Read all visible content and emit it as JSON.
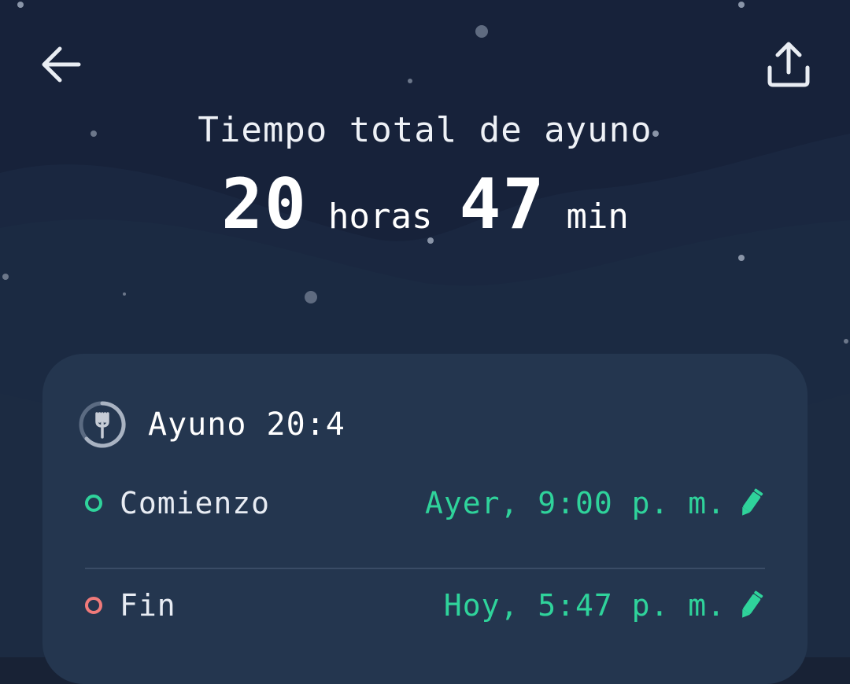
{
  "header": {
    "back_icon": "arrow-left-icon",
    "share_icon": "share-upload-icon"
  },
  "summary": {
    "title": "Tiempo total de ayuno",
    "hours": "20",
    "hours_unit": "horas",
    "minutes": "47",
    "minutes_unit": "min"
  },
  "card": {
    "plan_icon": "fork-timer-icon",
    "plan_name": "Ayuno 20:4",
    "start": {
      "label": "Comienzo",
      "value": "Ayer, 9:00 p. m.",
      "status_color": "#2fd39b",
      "edit_icon": "pencil-icon"
    },
    "end": {
      "label": "Fin",
      "value": "Hoy, 5:47 p. m.",
      "status_color": "#f07a7a",
      "edit_icon": "pencil-icon"
    }
  },
  "colors": {
    "accent": "#2fd39b",
    "card": "#24364f",
    "background": "#182235"
  }
}
